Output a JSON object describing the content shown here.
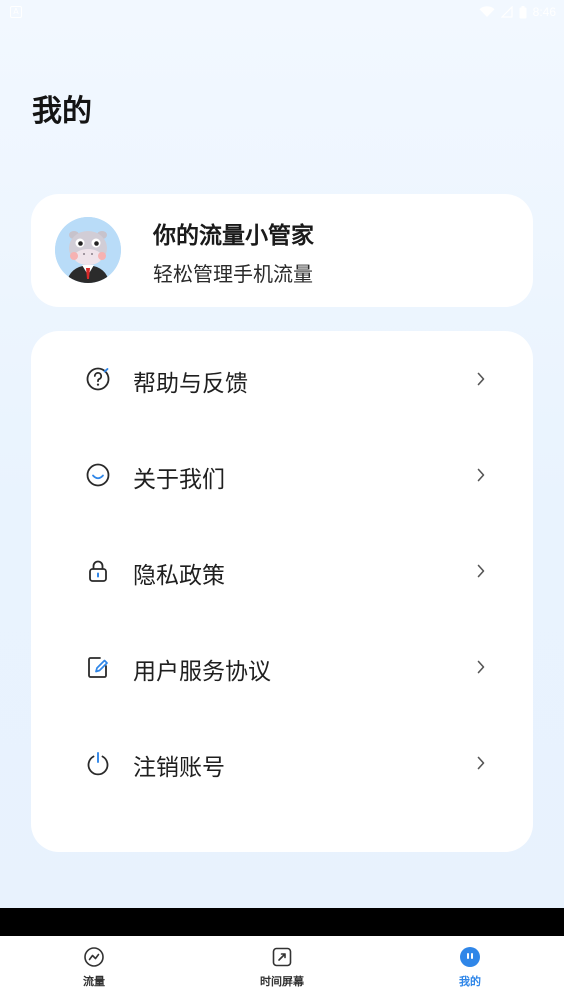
{
  "status_bar": {
    "time": "8:46",
    "app_icon_glyph": "A"
  },
  "page": {
    "title": "我的"
  },
  "profile": {
    "title": "你的流量小管家",
    "subtitle": "轻松管理手机流量",
    "avatar_icon": "cartoon-hippo-avatar"
  },
  "menu": {
    "items": [
      {
        "label": "帮助与反馈",
        "icon": "help-feedback-icon"
      },
      {
        "label": "关于我们",
        "icon": "smile-icon"
      },
      {
        "label": "隐私政策",
        "icon": "lock-icon"
      },
      {
        "label": "用户服务协议",
        "icon": "edit-document-icon"
      },
      {
        "label": "注销账号",
        "icon": "power-icon"
      }
    ]
  },
  "bottom_nav": {
    "items": [
      {
        "label": "流量",
        "icon": "traffic-icon",
        "active": false
      },
      {
        "label": "时间屏幕",
        "icon": "screen-time-icon",
        "active": false
      },
      {
        "label": "我的",
        "icon": "profile-icon",
        "active": true
      }
    ]
  },
  "colors": {
    "accent": "#2f86e8",
    "background": "#e9f3fe",
    "card": "#ffffff",
    "text_primary": "#1f1f1f"
  }
}
